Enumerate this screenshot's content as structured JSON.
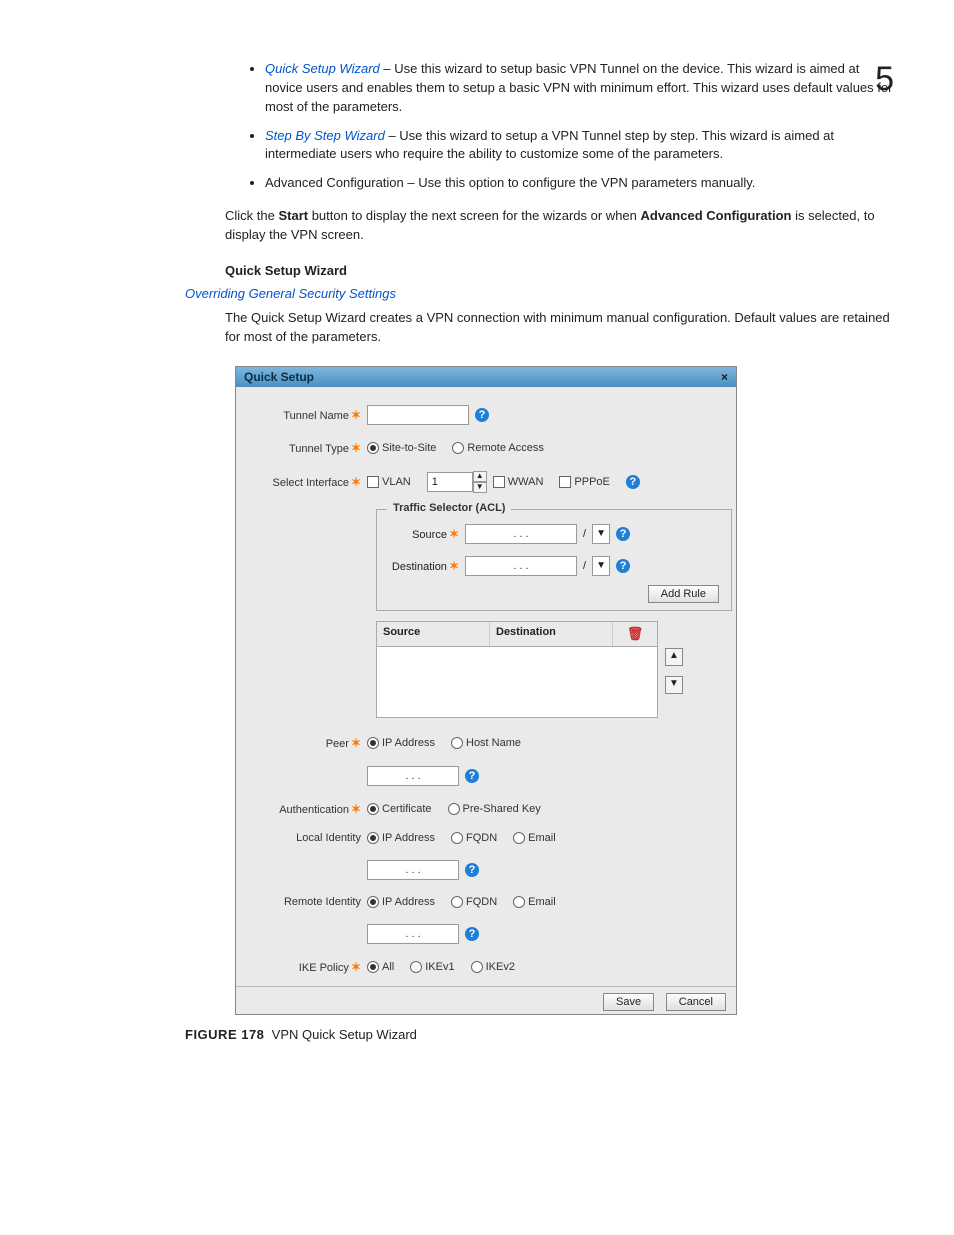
{
  "pageNumber": "5",
  "bullets": {
    "b1_link": "Quick Setup Wizard",
    "b1_text": " – Use this wizard to setup basic VPN Tunnel on the device. This wizard is aimed at novice users and enables them to setup a basic VPN with minimum effort. This wizard uses default values for most of the parameters.",
    "b2_link": "Step By Step Wizard",
    "b2_text": " – Use this wizard to setup a VPN Tunnel step by step. This wizard is aimed at intermediate users who require the ability to customize some of the parameters.",
    "b3_text": "Advanced Configuration – Use this option to configure the VPN parameters manually."
  },
  "para1_a": "Click the ",
  "para1_b": "Start",
  "para1_c": " button to display the next screen for the wizards or when ",
  "para1_d": "Advanced Configuration",
  "para1_e": " is selected, to display the VPN screen.",
  "section_head": "Quick Setup Wizard",
  "sub_link": "Overriding General Security Settings",
  "para2": "The Quick Setup Wizard creates a VPN connection with minimum manual configuration. Default values are retained for most of the parameters.",
  "dialog": {
    "title": "Quick Setup",
    "close": "×",
    "rows": {
      "tunnel_name": "Tunnel Name",
      "tunnel_type": "Tunnel Type",
      "tt_site": "Site-to-Site",
      "tt_remote": "Remote Access",
      "select_iface": "Select Interface",
      "vlan": "VLAN",
      "vlan_val": "1",
      "wwan": "WWAN",
      "pppoe": "PPPoE",
      "fieldset_legend": "Traffic Selector (ACL)",
      "source": "Source",
      "destination": "Destination",
      "add_rule": "Add Rule",
      "grid_source": "Source",
      "grid_dest": "Destination",
      "peer": "Peer",
      "peer_ip": "IP Address",
      "peer_host": "Host Name",
      "auth": "Authentication",
      "auth_cert": "Certificate",
      "auth_psk": "Pre-Shared Key",
      "local_id": "Local Identity",
      "id_ip": "IP Address",
      "id_fqdn": "FQDN",
      "id_email": "Email",
      "remote_id": "Remote Identity",
      "ike": "IKE Policy",
      "ike_all": "All",
      "ike_v1": "IKEv1",
      "ike_v2": "IKEv2",
      "save": "Save",
      "cancel": "Cancel"
    },
    "ip_dots": ".   .   .",
    "star": "✶",
    "help": "?",
    "slash": "/",
    "trash": "🗑",
    "up": "▲",
    "down": "▼"
  },
  "figure": {
    "prefix": "FIGURE 178",
    "caption": "VPN Quick Setup Wizard"
  }
}
